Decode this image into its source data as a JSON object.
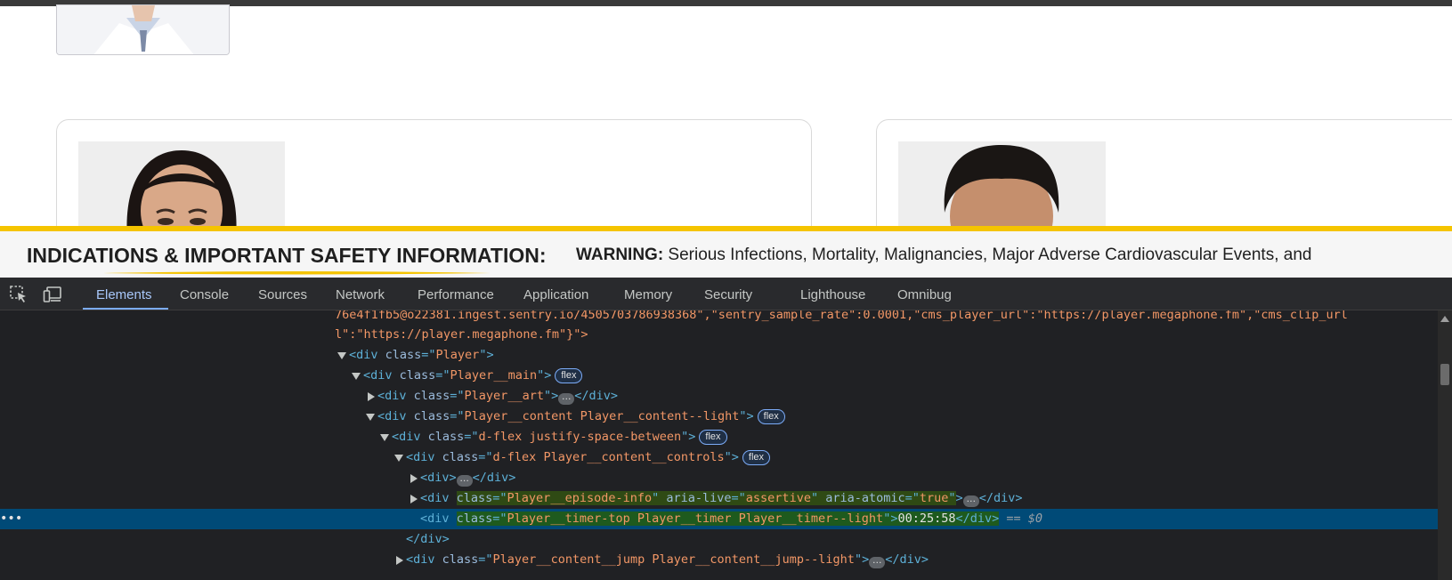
{
  "isi_banner": {
    "title": "INDICATIONS & IMPORTANT SAFETY INFORMATION:",
    "warning_label": "WARNING:",
    "warning_text": " Serious Infections, Mortality, Malignancies, Major Adverse Cardiovascular Events, and"
  },
  "devtools": {
    "tabs": [
      {
        "label": "Elements",
        "active": true
      },
      {
        "label": "Console"
      },
      {
        "label": "Sources"
      },
      {
        "label": "Network"
      },
      {
        "label": "Performance"
      },
      {
        "label": "Application"
      },
      {
        "label": "Memory"
      },
      {
        "label": "Security"
      },
      {
        "label": "Lighthouse"
      },
      {
        "label": "Omnibug"
      }
    ],
    "dom": {
      "line0": "76e4f1fb5@o22381.ingest.sentry.io/4505703786938368\",\"sentry_sample_rate\":0.0001,\"cms_player_url\":\"https://player.megaphone.fm\",\"cms_clip_url",
      "line1": "l\":\"https://player.megaphone.fm\"}\">",
      "player_class": "Player",
      "player_main_class": "Player__main",
      "player_art_class": "Player__art",
      "player_content_class": "Player__content Player__content--light",
      "dflex_class": "d-flex justify-space-between",
      "controls_class": "d-flex Player__content__controls",
      "episode_info_class": "Player__episode-info",
      "aria_live_value": "assertive",
      "aria_atomic_value": "true",
      "timer_class": "Player__timer-top Player__timer Player__timer--light",
      "timer_value": "00:25:58",
      "jump_class": "Player__content__jump Player__content__jump--light",
      "flex_badge": "flex",
      "ellipsis": "…",
      "selected_suffix": "== $0",
      "row_dots": "•••"
    }
  }
}
